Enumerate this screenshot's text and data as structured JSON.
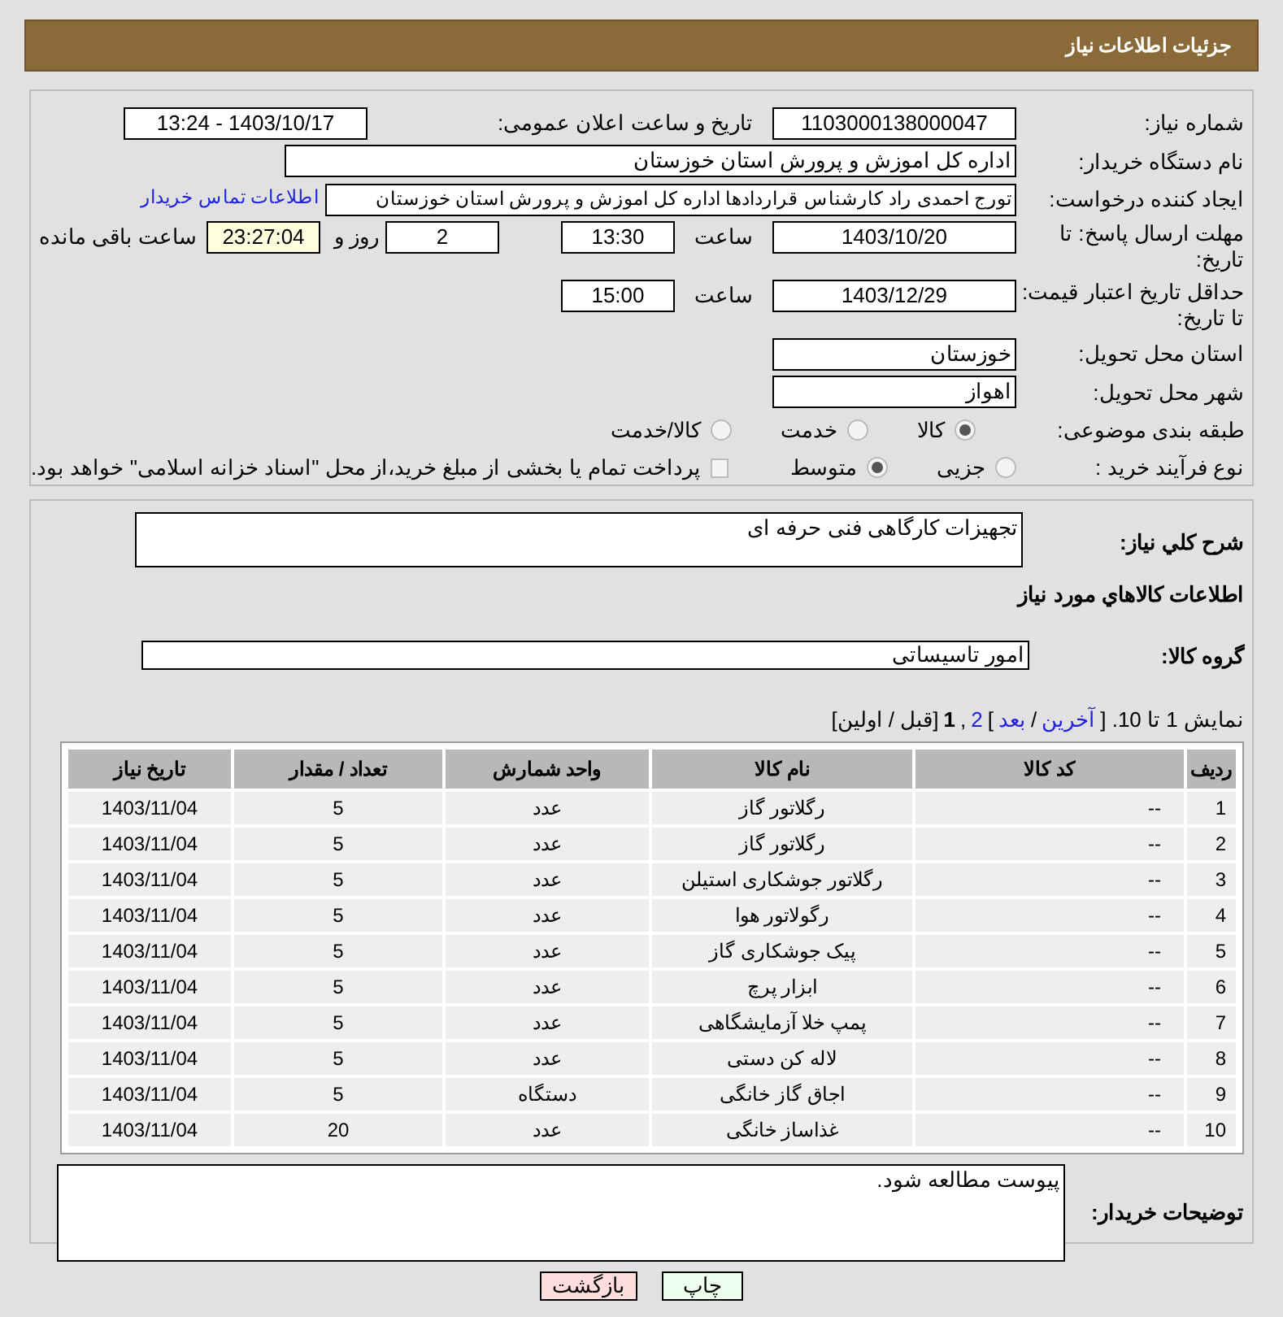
{
  "header": {
    "title": "جزئیات اطلاعات نیاز"
  },
  "form": {
    "need_number": {
      "label": "شماره نیاز:",
      "value": "1103000138000047"
    },
    "announce": {
      "label": "تاریخ و ساعت اعلان عمومی:",
      "value": "1403/10/17 - 13:24"
    },
    "buyer": {
      "label": "نام دستگاه خریدار:",
      "value": "اداره کل اموزش و پرورش استان خوزستان"
    },
    "requester": {
      "label": "ایجاد کننده درخواست:",
      "value": "تورج احمدی راد کارشناس قراردادها اداره کل اموزش و پرورش استان خوزستان",
      "link": "اطلاعات تماس خریدار"
    },
    "deadline": {
      "label": "مهلت ارسال پاسخ: تا تاریخ:",
      "date": "1403/10/20",
      "time_label": "ساعت",
      "time": "13:30",
      "days": "2",
      "days_label": "روز و",
      "remaining": "23:27:04",
      "remaining_label": "ساعت باقی مانده"
    },
    "validity": {
      "label": "حداقل تاریخ اعتبار قیمت: تا تاریخ:",
      "date": "1403/12/29",
      "time_label": "ساعت",
      "time": "15:00"
    },
    "province": {
      "label": "استان محل تحویل:",
      "value": "خوزستان"
    },
    "city": {
      "label": "شهر محل تحویل:",
      "value": "اهواز"
    },
    "category": {
      "label": "طبقه بندی موضوعی:",
      "options": [
        {
          "label": "کالا",
          "selected": true
        },
        {
          "label": "خدمت",
          "selected": false
        },
        {
          "label": "کالا/خدمت",
          "selected": false
        }
      ]
    },
    "process": {
      "label": "نوع فرآیند خرید :",
      "options": [
        {
          "label": "جزیی",
          "selected": false
        },
        {
          "label": "متوسط",
          "selected": true
        }
      ],
      "payment": {
        "label": "پرداخت تمام یا بخشی از مبلغ خرید،از محل \"اسناد خزانه اسلامی\" خواهد بود.",
        "checked": false
      }
    }
  },
  "details": {
    "description": {
      "label": "شرح کلي نياز:",
      "value": "تجهیزات کارگاهی فنی حرفه ای"
    },
    "section_title": "اطلاعات کالاهاي مورد نياز",
    "group": {
      "label": "گروه کالا:",
      "value": "امور تاسیساتی"
    },
    "pagination": [
      {
        "kind": "text",
        "text": "نمایش 1 تا 10. ["
      },
      {
        "kind": "link",
        "text": "آخرین"
      },
      {
        "kind": "text",
        "text": "/"
      },
      {
        "kind": "link",
        "text": "بعد"
      },
      {
        "kind": "text",
        "text": "]"
      },
      {
        "kind": "link",
        "text": "2"
      },
      {
        "kind": "text",
        "text": ","
      },
      {
        "kind": "current",
        "text": "1"
      },
      {
        "kind": "text",
        "text": "[قبل / اولین]"
      }
    ],
    "table": {
      "columns": [
        "ردیف",
        "کد کالا",
        "نام کالا",
        "واحد شمارش",
        "تعداد / مقدار",
        "تاریخ نیاز"
      ],
      "rows": [
        [
          "1",
          "--",
          "رگلاتور گاز",
          "عدد",
          "5",
          "1403/11/04"
        ],
        [
          "2",
          "--",
          "رگلاتور گاز",
          "عدد",
          "5",
          "1403/11/04"
        ],
        [
          "3",
          "--",
          "رگلاتور جوشکاری استیلن",
          "عدد",
          "5",
          "1403/11/04"
        ],
        [
          "4",
          "--",
          "رگولاتور هوا",
          "عدد",
          "5",
          "1403/11/04"
        ],
        [
          "5",
          "--",
          "پیک جوشکاری گاز",
          "عدد",
          "5",
          "1403/11/04"
        ],
        [
          "6",
          "--",
          "ابزار پرچ",
          "عدد",
          "5",
          "1403/11/04"
        ],
        [
          "7",
          "--",
          "پمپ خلا آزمایشگاهی",
          "عدد",
          "5",
          "1403/11/04"
        ],
        [
          "8",
          "--",
          "لاله کن دستی",
          "عدد",
          "5",
          "1403/11/04"
        ],
        [
          "9",
          "--",
          "اجاق گاز خانگی",
          "دستگاه",
          "5",
          "1403/11/04"
        ],
        [
          "10",
          "--",
          "غذاساز خانگی",
          "عدد",
          "20",
          "1403/11/04"
        ]
      ]
    },
    "notes": {
      "label": "توضیحات خریدار:",
      "value": "پیوست مطالعه شود."
    }
  },
  "buttons": [
    {
      "kind": "print",
      "label": "چاپ"
    },
    {
      "kind": "back",
      "label": "بازگشت"
    }
  ]
}
